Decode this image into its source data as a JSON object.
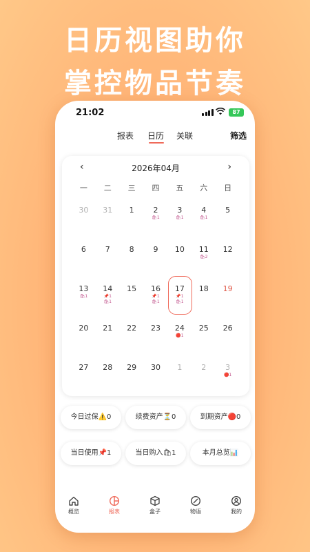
{
  "headline": {
    "line1": "日历视图助你",
    "line2": "掌控物品节奏"
  },
  "status": {
    "time": "21:02",
    "battery": "87"
  },
  "tabs": [
    {
      "label": "报表"
    },
    {
      "label": "日历"
    },
    {
      "label": "关联"
    }
  ],
  "filter_label": "筛选",
  "calendar": {
    "title": "2026年04月",
    "prev": "‹",
    "next": "›",
    "weekdays": [
      "一",
      "二",
      "三",
      "四",
      "五",
      "六",
      "日"
    ],
    "weeks": [
      [
        {
          "d": "30",
          "other": true
        },
        {
          "d": "31",
          "other": true
        },
        {
          "d": "1"
        },
        {
          "d": "2",
          "marks": [
            "🛍1"
          ]
        },
        {
          "d": "3",
          "marks": [
            "🛍1"
          ]
        },
        {
          "d": "4",
          "marks": [
            "🛍1"
          ]
        },
        {
          "d": "5"
        }
      ],
      [
        {
          "d": "6"
        },
        {
          "d": "7"
        },
        {
          "d": "8"
        },
        {
          "d": "9"
        },
        {
          "d": "10"
        },
        {
          "d": "11",
          "marks": [
            "🛍2"
          ]
        },
        {
          "d": "12"
        }
      ],
      [
        {
          "d": "13",
          "marks": [
            "🛍1"
          ]
        },
        {
          "d": "14",
          "marks": [
            "📌1",
            "🛍1"
          ]
        },
        {
          "d": "15"
        },
        {
          "d": "16",
          "marks": [
            "📌1",
            "🛍1"
          ]
        },
        {
          "d": "17",
          "selected": true,
          "marks": [
            "📌1",
            "🛍1"
          ]
        },
        {
          "d": "18"
        },
        {
          "d": "19",
          "sunday": true
        }
      ],
      [
        {
          "d": "20"
        },
        {
          "d": "21"
        },
        {
          "d": "22"
        },
        {
          "d": "23"
        },
        {
          "d": "24",
          "marks": [
            "🔴1"
          ]
        },
        {
          "d": "25"
        },
        {
          "d": "26"
        }
      ],
      [
        {
          "d": "27"
        },
        {
          "d": "28"
        },
        {
          "d": "29"
        },
        {
          "d": "30"
        },
        {
          "d": "1",
          "other": true
        },
        {
          "d": "2",
          "other": true
        },
        {
          "d": "3",
          "other": true,
          "marks": [
            "🔴1"
          ]
        }
      ]
    ]
  },
  "summary": [
    {
      "label": "今日过保⚠️0"
    },
    {
      "label": "续费资产⏳0"
    },
    {
      "label": "到期资产🔴0"
    },
    {
      "label": "当日使用📌1"
    },
    {
      "label": "当日购入🛍1"
    },
    {
      "label": "本月总览📊"
    }
  ],
  "bottom_nav": [
    {
      "label": "概览",
      "icon": "home-icon"
    },
    {
      "label": "报表",
      "icon": "pie-chart-icon",
      "active": true
    },
    {
      "label": "盒子",
      "icon": "box-icon"
    },
    {
      "label": "物语",
      "icon": "compass-icon"
    },
    {
      "label": "我的",
      "icon": "user-icon"
    }
  ],
  "colors": {
    "accent": "#ef6a5a",
    "background": "#ffb477"
  }
}
